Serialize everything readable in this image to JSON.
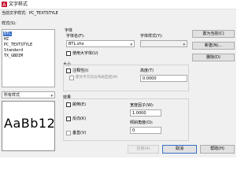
{
  "window": {
    "title": "文字样式"
  },
  "current_style": {
    "label": "当前文字样式:",
    "value": "PC_TEXTSTYLE"
  },
  "styles": {
    "label": "样式(S):",
    "items": [
      "BTL",
      "HZ",
      "PC_TEXTSTYLE",
      "Standard",
      "TX_GBDIM"
    ],
    "selected_index": 0
  },
  "filter": {
    "label": "所有样式"
  },
  "preview": {
    "text": "AaBb12"
  },
  "font": {
    "group_label": "字体",
    "name_label": "字体名(F):",
    "name_value": "BTL.shx",
    "font_style_label": "字体样式(Y):",
    "font_style_value": "",
    "use_big_font_label": "使用大字体(U)",
    "use_big_font_checked": false
  },
  "size": {
    "group_label": "大小",
    "annotative_label": "注释性(I)",
    "annotative_checked": false,
    "match_layout_label": "使文字方向与布局匹配(M)",
    "height_label": "高度(T)",
    "height_value": "0.0000"
  },
  "effects": {
    "group_label": "效果",
    "upside_down_label": "颠倒(E)",
    "backwards_label": "反向(K)",
    "vertical_label": "垂直(V)",
    "width_factor_label": "宽度因子(W):",
    "width_factor_value": "1.0000",
    "oblique_label": "倾斜角度(O):",
    "oblique_value": "0"
  },
  "buttons": {
    "set_current": "置为当前(C)",
    "new": "新建(N)...",
    "delete": "删除(D)",
    "apply": "应用(A)",
    "cancel": "取消",
    "help": "帮助(H)"
  }
}
